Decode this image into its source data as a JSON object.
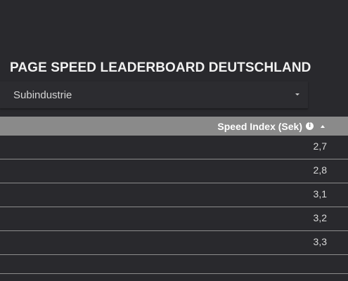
{
  "header": {
    "title": "PAGE SPEED LEADERBOARD DEUTSCHLAND"
  },
  "filter": {
    "label": "Subindustrie",
    "icon": "chevron-down-icon"
  },
  "table": {
    "column_header": "Speed Index (Sek)",
    "info_icon": "info-icon",
    "info_glyph": "i",
    "sort_icon": "sort-ascending-icon",
    "rows": [
      {
        "value": "2,7"
      },
      {
        "value": "2,8"
      },
      {
        "value": "3,1"
      },
      {
        "value": "3,2"
      },
      {
        "value": "3,3"
      }
    ]
  },
  "colors": {
    "background": "#29292d",
    "header_bar": "#8a8a8a",
    "text": "#f1f1f1",
    "divider": "#8c8c8c"
  }
}
